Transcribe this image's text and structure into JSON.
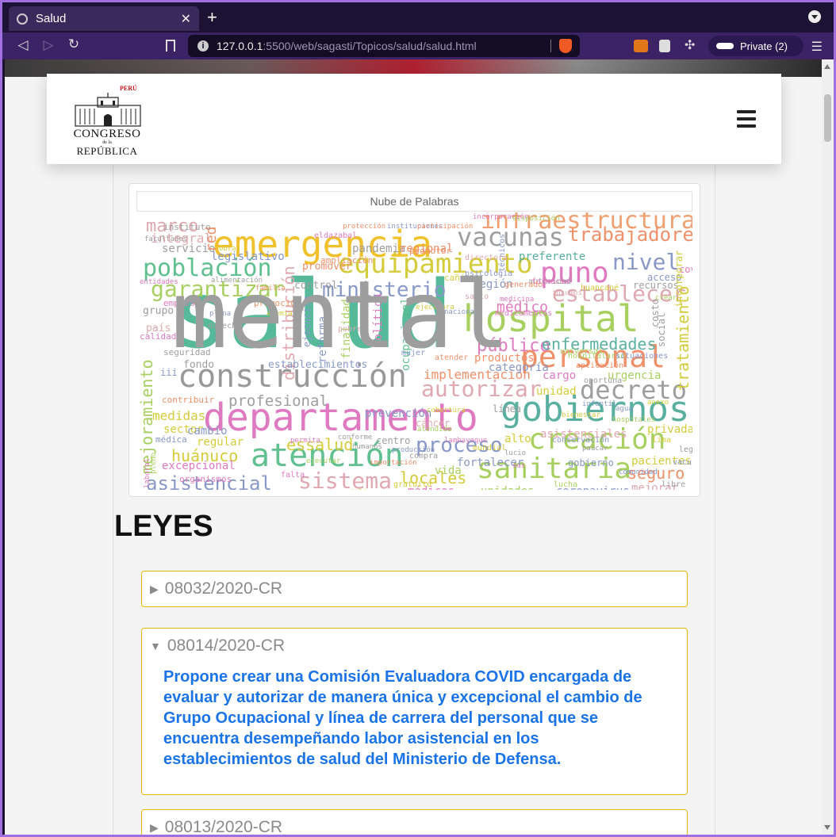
{
  "browser": {
    "tab_title": "Salud",
    "url_host": "127.0.0.1",
    "url_path": ":5500/web/sagasti/Topicos/salud/salud.html",
    "private_label": "Private (2)"
  },
  "logo": {
    "country": "PERÚ",
    "line1": "CONGRESO",
    "line2": "de la",
    "line3": "REPÚBLICA"
  },
  "wordcloud": {
    "title": "Nube de Palabras",
    "words": [
      {
        "t": "salud",
        "c": "#55b99a"
      },
      {
        "t": "emergencia",
        "c": "#f0c12a"
      },
      {
        "t": "departamento",
        "c": "#e07ac0"
      },
      {
        "t": "hospital",
        "c": "#a8d060"
      },
      {
        "t": "gobiernos",
        "c": "#5ab0a0"
      },
      {
        "t": "construcción",
        "c": "#999999"
      },
      {
        "t": "atención",
        "c": "#60c090"
      },
      {
        "t": "personal",
        "c": "#f0906a"
      },
      {
        "t": "equipamiento",
        "c": "#d4cc3a"
      },
      {
        "t": "sanitaria",
        "c": "#a8d060"
      },
      {
        "t": "creación",
        "c": "#a8d060"
      },
      {
        "t": "vacunas",
        "c": "#9e9e9e"
      },
      {
        "t": "infraestructura",
        "c": "#f0a070"
      },
      {
        "t": "población",
        "c": "#60c090"
      },
      {
        "t": "puno",
        "c": "#e07ac0"
      },
      {
        "t": "decreto",
        "c": "#9e9e9e"
      },
      {
        "t": "trabajadores",
        "c": "#f0906a"
      },
      {
        "t": "nivel",
        "c": "#8898c8"
      },
      {
        "t": "ministerio",
        "c": "#8898c8"
      },
      {
        "t": "establecer",
        "c": "#e0a8b0"
      },
      {
        "t": "garantizar",
        "c": "#a8d060"
      },
      {
        "t": "autorizar",
        "c": "#e0a8b0"
      },
      {
        "t": "sistema",
        "c": "#e0a8b0"
      },
      {
        "t": "asistencial",
        "c": "#8898c8"
      },
      {
        "t": "proceso",
        "c": "#8898c8"
      },
      {
        "t": "público",
        "c": "#e07ac0"
      },
      {
        "t": "enfermedades",
        "c": "#5ab0a0"
      },
      {
        "t": "marco",
        "c": "#e0a8b0"
      },
      {
        "t": "profesional",
        "c": "#9e9e9e"
      },
      {
        "t": "mejoramiento",
        "c": "#a8d060"
      },
      {
        "t": "tratamiento",
        "c": "#d4cc3a"
      },
      {
        "t": "distribución",
        "c": "#e0a8b0"
      },
      {
        "t": "essalud",
        "c": "#d4cc3a"
      },
      {
        "t": "locales",
        "c": "#d4cc3a"
      },
      {
        "t": "huánuco",
        "c": "#d4cc3a"
      },
      {
        "t": "seguro",
        "c": "#f0906a"
      },
      {
        "t": "implementación",
        "c": "#f0906a"
      },
      {
        "t": "médico",
        "c": "#e07ac0"
      },
      {
        "t": "región",
        "c": "#8898c8"
      },
      {
        "t": "pandemia",
        "c": "#9e9e9e"
      },
      {
        "t": "regional",
        "c": "#f0906a"
      },
      {
        "t": "legislativo",
        "c": "#8898c8"
      },
      {
        "t": "integral",
        "c": "#e0a8b0"
      },
      {
        "t": "servicio",
        "c": "#9e9e9e"
      },
      {
        "t": "preferente",
        "c": "#5ab0a0"
      },
      {
        "t": "productos",
        "c": "#f0906a"
      },
      {
        "t": "categoría",
        "c": "#8898c8"
      },
      {
        "t": "prevención",
        "c": "#8898c8"
      },
      {
        "t": "unidad",
        "c": "#d4cc3a"
      },
      {
        "t": "cargo",
        "c": "#e07ac0"
      },
      {
        "t": "urgencia",
        "c": "#a8d060"
      },
      {
        "t": "medidas",
        "c": "#d4cc3a"
      },
      {
        "t": "sector",
        "c": "#d4cc3a"
      },
      {
        "t": "regular",
        "c": "#d4cc3a"
      },
      {
        "t": "excepcional",
        "c": "#e07ac0"
      },
      {
        "t": "cambio",
        "c": "#8898c8"
      },
      {
        "t": "fortalecer",
        "c": "#8898c8"
      },
      {
        "t": "alto",
        "c": "#d4cc3a"
      },
      {
        "t": "asistenciales",
        "c": "#e0a8b0"
      },
      {
        "t": "privadas",
        "c": "#d4cc3a"
      },
      {
        "t": "pacientes",
        "c": "#d4cc3a"
      },
      {
        "t": "vida",
        "c": "#a8d060"
      },
      {
        "t": "médicos",
        "c": "#e07ac0"
      },
      {
        "t": "unidades",
        "c": "#a8d060"
      },
      {
        "t": "coronavirus",
        "c": "#8898c8"
      },
      {
        "t": "mejorar",
        "c": "#e0a8b0"
      },
      {
        "t": "establecimientos",
        "c": "#8898c8"
      },
      {
        "t": "control",
        "c": "#9e9e9e"
      },
      {
        "t": "promover",
        "c": "#f0906a"
      },
      {
        "t": "grupo",
        "c": "#9e9e9e"
      },
      {
        "t": "país",
        "c": "#e0a8b0"
      },
      {
        "t": "fondo",
        "c": "#9e9e9e"
      },
      {
        "t": "red",
        "c": "#f0906a"
      },
      {
        "t": "reforma",
        "c": "#8898c8"
      },
      {
        "t": "finalidad",
        "c": "#a8d060"
      },
      {
        "t": "política",
        "c": "#e07ac0"
      },
      {
        "t": "ocupacional",
        "c": "#60c090"
      },
      {
        "t": "ejecución",
        "c": "#8898c8"
      },
      {
        "t": "social",
        "c": "#9e9e9e"
      },
      {
        "t": "costo",
        "c": "#9e9e9e"
      },
      {
        "t": "covid",
        "c": "#e07ac0"
      },
      {
        "t": "iii",
        "c": "#8898c8"
      },
      {
        "t": "gobierno",
        "c": "#8898c8"
      },
      {
        "t": "centro",
        "c": "#9e9e9e"
      },
      {
        "t": "cáncer",
        "c": "#e0a8b0"
      },
      {
        "t": "línea",
        "c": "#9e9e9e"
      },
      {
        "t": "recursos",
        "c": "#9e9e9e"
      },
      {
        "t": "acceso",
        "c": "#8898c8"
      },
      {
        "t": "calidad",
        "c": "#e07ac0"
      },
      {
        "t": "seguridad",
        "c": "#9e9e9e"
      },
      {
        "t": "instituto",
        "c": "#9e9e9e"
      },
      {
        "t": "empresas",
        "c": "#e07ac0"
      },
      {
        "t": "promoción",
        "c": "#f0906a"
      },
      {
        "t": "contribuir",
        "c": "#f0906a"
      },
      {
        "t": "organismos",
        "c": "#e07ac0"
      },
      {
        "t": "médica",
        "c": "#8898c8"
      },
      {
        "t": "promotor",
        "c": "#f0906a"
      },
      {
        "t": "cañón",
        "c": "#d4cc3a"
      },
      {
        "t": "ampliación",
        "c": "#f0906a"
      },
      {
        "t": "derecho",
        "c": "#9e9e9e"
      },
      {
        "t": "mujer",
        "c": "#8898c8"
      },
      {
        "t": "atender",
        "c": "#f0906a"
      },
      {
        "t": "pobre",
        "c": "#e0a8b0"
      },
      {
        "t": "autoridad",
        "c": "#9e9e9e"
      },
      {
        "t": "medicamentos",
        "c": "#e07ac0"
      },
      {
        "t": "oportuna",
        "c": "#9e9e9e"
      },
      {
        "t": "técnicos",
        "c": "#8898c8"
      },
      {
        "t": "incorporar",
        "c": "#d4cc3a"
      },
      {
        "t": "directora",
        "c": "#e0a8b0"
      },
      {
        "t": "gratuito",
        "c": "#d4cc3a"
      },
      {
        "t": "farmacia",
        "c": "#e07ac0"
      },
      {
        "t": "vacuna",
        "c": "#8898c8"
      },
      {
        "t": "lucha",
        "c": "#a8d060"
      },
      {
        "t": "libre",
        "c": "#9e9e9e"
      },
      {
        "t": "falta",
        "c": "#e07ac0"
      },
      {
        "t": "legal",
        "c": "#9e9e9e"
      },
      {
        "t": "lima",
        "c": "#d4cc3a"
      },
      {
        "t": "psicología",
        "c": "#8898c8"
      },
      {
        "t": "huancané",
        "c": "#d4cc3a"
      },
      {
        "t": "generado",
        "c": "#f0906a"
      },
      {
        "t": "santo",
        "c": "#e0a8b0"
      },
      {
        "t": "hospitalario",
        "c": "#a8d060"
      },
      {
        "t": "aplicación",
        "c": "#f0906a"
      },
      {
        "t": "situaciones",
        "c": "#8898c8"
      },
      {
        "t": "conservación",
        "c": "#8898c8"
      },
      {
        "t": "compra",
        "c": "#9e9e9e"
      },
      {
        "t": "mundial",
        "c": "#d4cc3a"
      },
      {
        "t": "universal",
        "c": "#a8d060"
      },
      {
        "t": "eldazabal",
        "c": "#e07ac0"
      },
      {
        "t": "protección",
        "c": "#f0906a"
      },
      {
        "t": "instituciones",
        "c": "#8898c8"
      },
      {
        "t": "participación",
        "c": "#f0906a"
      },
      {
        "t": "incorporación",
        "c": "#e07ac0"
      },
      {
        "t": "disposición",
        "c": "#a8d060"
      },
      {
        "t": "obras",
        "c": "#d4cc3a"
      },
      {
        "t": "facultades",
        "c": "#9e9e9e"
      },
      {
        "t": "entidades",
        "c": "#e07ac0"
      },
      {
        "t": "alimentación",
        "c": "#9e9e9e"
      },
      {
        "t": "ejecutora",
        "c": "#d4cc3a"
      },
      {
        "t": "nacional",
        "c": "#8898c8"
      },
      {
        "t": "medicina",
        "c": "#e07ac0"
      },
      {
        "t": "crear",
        "c": "#a8d060"
      },
      {
        "t": "insumos",
        "c": "#e0a8b0"
      },
      {
        "t": "bienestar",
        "c": "#d4cc3a"
      },
      {
        "t": "infantil",
        "c": "#8898c8"
      },
      {
        "t": "atendida",
        "c": "#a8d060"
      },
      {
        "t": "cobertura",
        "c": "#d4cc3a"
      },
      {
        "t": "humanos",
        "c": "#9e9e9e"
      },
      {
        "t": "producción",
        "c": "#8898c8"
      },
      {
        "t": "lambayeque",
        "c": "#e07ac0"
      },
      {
        "t": "importación",
        "c": "#f0906a"
      },
      {
        "t": "conforme",
        "c": "#9e9e9e"
      },
      {
        "t": "permita",
        "c": "#e07ac0"
      },
      {
        "t": "ejecutar",
        "c": "#a8d060"
      },
      {
        "t": "agua",
        "c": "#8898c8"
      },
      {
        "t": "pública",
        "c": "#d4cc3a"
      },
      {
        "t": "laboral",
        "c": "#e07ac0"
      },
      {
        "t": "pleno",
        "c": "#a8d060"
      },
      {
        "t": "lucio",
        "c": "#9e9e9e"
      },
      {
        "t": "paucar",
        "c": "#9e9e9e"
      },
      {
        "t": "anexo",
        "c": "#d4cc3a"
      },
      {
        "t": "comunidad",
        "c": "#8898c8"
      },
      {
        "t": "hospitales",
        "c": "#a8d060"
      },
      {
        "t": "sus",
        "c": "#e07ac0"
      },
      {
        "t": "plena",
        "c": "#8898c8"
      },
      {
        "t": "familia",
        "c": "#f0906a"
      },
      {
        "t": "anemia",
        "c": "#d4cc3a"
      },
      {
        "t": "mental",
        "c": "#9e9e9e"
      }
    ]
  },
  "leyes": {
    "heading": "LEYES",
    "items": [
      {
        "code": "08032/2020-CR",
        "expanded": false,
        "text": ""
      },
      {
        "code": "08014/2020-CR",
        "expanded": true,
        "text": "Propone crear una Comisión Evaluadora COVID encargada de evaluar y autorizar de manera única y excepcional el cambio de Grupo Ocupacional y línea de carrera del personal que se encuentra desempeñando labor asistencial en los establecimientos de salud del Ministerio de Defensa."
      },
      {
        "code": "08013/2020-CR",
        "expanded": false,
        "text": ""
      }
    ]
  },
  "icons": {
    "collapsed": "▶",
    "expanded": "▼"
  }
}
